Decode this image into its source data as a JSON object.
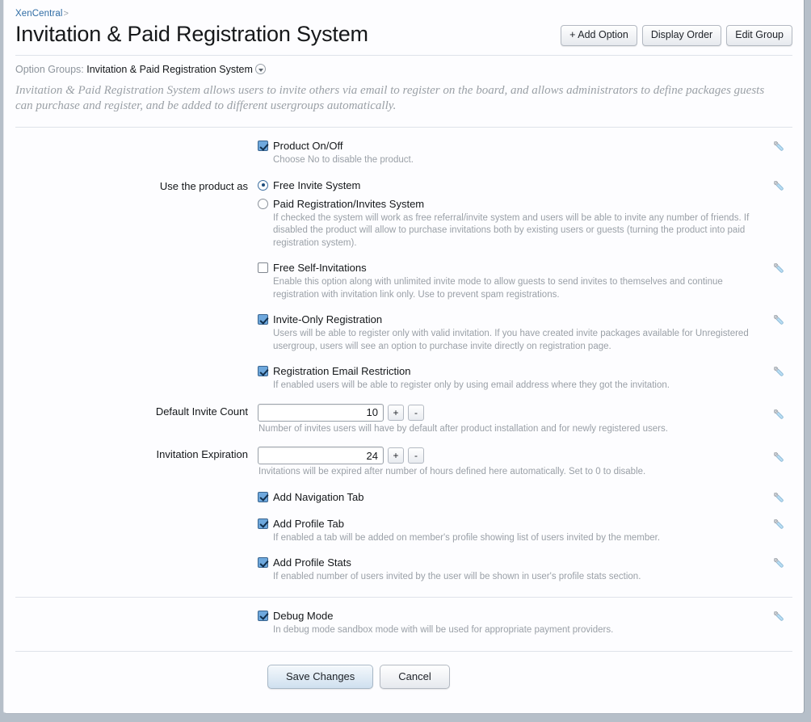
{
  "breadcrumb": {
    "root": "XenCentral",
    "separator": ">"
  },
  "header": {
    "title": "Invitation & Paid Registration System",
    "buttons": [
      {
        "label": "+ Add Option",
        "name": "add-option-button"
      },
      {
        "label": "Display Order",
        "name": "display-order-button"
      },
      {
        "label": "Edit Group",
        "name": "edit-group-button"
      }
    ]
  },
  "option_groups": {
    "label": "Option Groups:",
    "value": "Invitation & Paid Registration System"
  },
  "group_description": "Invitation & Paid Registration System allows users to invite others via email to register on the board, and allows administrators to define packages guests can purchase and register, and be added to different usergroups automatically.",
  "options": [
    {
      "label": "",
      "type": "checkbox",
      "title": "Product On/Off",
      "checked": true,
      "hint": "Choose No to disable the product."
    },
    {
      "label": "Use the product as",
      "type": "radio",
      "radios": [
        {
          "title": "Free Invite System",
          "checked": true
        },
        {
          "title": "Paid Registration/Invites System",
          "checked": false
        }
      ],
      "hint": "If checked the system will work as free referral/invite system and users will be able to invite any number of friends. If disabled the product will allow to purchase invitations both by existing users or guests (turning the product into paid registration system)."
    },
    {
      "label": "",
      "type": "checkbox",
      "title": "Free Self-Invitations",
      "checked": false,
      "hint": "Enable this option along with unlimited invite mode to allow guests to send invites to themselves and continue registration with invitation link only. Use to prevent spam registrations."
    },
    {
      "label": "",
      "type": "checkbox",
      "title": "Invite-Only Registration",
      "checked": true,
      "hint": "Users will be able to register only with valid invitation. If you have created invite packages available for Unregistered usergroup, users will see an option to purchase invite directly on registration page."
    },
    {
      "label": "",
      "type": "checkbox",
      "title": "Registration Email Restriction",
      "checked": true,
      "hint": "If enabled users will be able to register only by using email address where they got the invitation."
    },
    {
      "label": "Default Invite Count",
      "type": "number",
      "value": "10",
      "plus": "+",
      "minus": "-",
      "hint": "Number of invites users will have by default after product installation and for newly registered users."
    },
    {
      "label": "Invitation Expiration",
      "type": "number",
      "value": "24",
      "plus": "+",
      "minus": "-",
      "hint": "Invitations will be expired after number of hours defined here automatically. Set to 0 to disable."
    },
    {
      "label": "",
      "type": "checkbox",
      "title": "Add Navigation Tab",
      "checked": true,
      "hint": ""
    },
    {
      "label": "",
      "type": "checkbox",
      "title": "Add Profile Tab",
      "checked": true,
      "hint": "If enabled a tab will be added on member's profile showing list of users invited by the member."
    },
    {
      "label": "",
      "type": "checkbox",
      "title": "Add Profile Stats",
      "checked": true,
      "hint": "If enabled number of users invited by the user will be shown in user's profile stats section."
    }
  ],
  "debug_option": {
    "label": "",
    "type": "checkbox",
    "title": "Debug Mode",
    "checked": true,
    "hint": "In debug mode sandbox mode with will be used for appropriate payment providers."
  },
  "footer": {
    "save_label": "Save Changes",
    "cancel_label": "Cancel"
  },
  "icons": {
    "wrench": "wrench-icon",
    "caret": "chevron-down-icon"
  },
  "colors": {
    "accent": "#2f6ca4",
    "checkbox_fill": "#6ea8dd",
    "wrench": "#8fc4e8",
    "page_background": "#b6bfc9",
    "card_background": "#fdfdff",
    "hint_text": "#9aa0a7"
  }
}
